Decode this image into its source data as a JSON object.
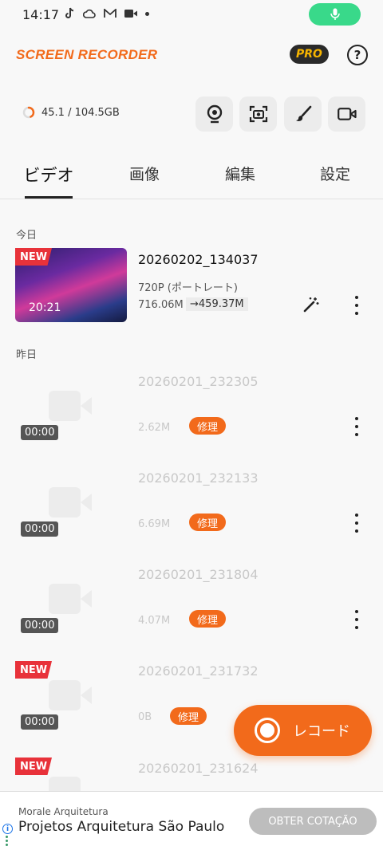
{
  "status_bar": {
    "time": "14:17",
    "icons": [
      "tiktok-icon",
      "cloud-icon",
      "gmail-icon",
      "video-icon"
    ]
  },
  "header": {
    "app_title": "SCREEN RECORDER",
    "pro_label": "PRO",
    "help_label": "?"
  },
  "storage": {
    "text": "45.1 / 104.5GB",
    "used_fraction": 0.43
  },
  "toolbar": {
    "tools": [
      "webcam-icon",
      "screenshot-icon",
      "brush-icon",
      "camera-icon"
    ]
  },
  "tabs": [
    {
      "label": "ビデオ",
      "active": true
    },
    {
      "label": "画像",
      "active": false
    },
    {
      "label": "編集",
      "active": false
    },
    {
      "label": "設定",
      "active": false
    }
  ],
  "sections": {
    "today": "今日",
    "yesterday": "昨日"
  },
  "videos": [
    {
      "name": "20260202_134037",
      "duration": "20:21",
      "resolution": "720P (ポートレート)",
      "size": "716.06M",
      "compressed_size": "459.37M",
      "is_new": true,
      "new_label": "NEW"
    },
    {
      "name": "20260201_232305",
      "duration": "00:00",
      "size": "2.62M",
      "repair_label": "修理"
    },
    {
      "name": "20260201_232133",
      "duration": "00:00",
      "size": "6.69M",
      "repair_label": "修理"
    },
    {
      "name": "20260201_231804",
      "duration": "00:00",
      "size": "4.07M",
      "repair_label": "修理"
    },
    {
      "name": "20260201_231732",
      "duration": "00:00",
      "size": "0B",
      "repair_label": "修理",
      "is_new": true,
      "new_label": "NEW"
    },
    {
      "name": "20260201_231624",
      "is_new": true,
      "new_label": "NEW"
    }
  ],
  "record_button": {
    "label": "レコード"
  },
  "ad": {
    "advertiser": "Morale Arquitetura",
    "headline": "Projetos Arquitetura São Paulo",
    "cta": "OBTER COTAÇÃO"
  },
  "colors": {
    "accent": "#f26a1b",
    "new_badge": "#e8323a",
    "mic_pill": "#39d98a"
  }
}
